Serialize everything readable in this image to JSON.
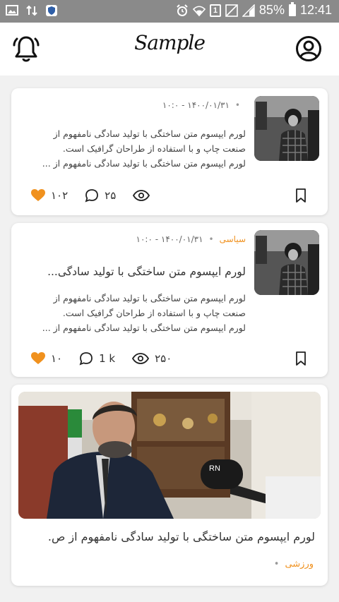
{
  "status_bar": {
    "sim_badge": "1",
    "battery": "85%",
    "time": "12:41"
  },
  "header": {
    "logo_text": "Sample"
  },
  "colors": {
    "accent": "#f0911e",
    "heart": "#f0911e"
  },
  "posts": [
    {
      "category": "",
      "date": "۱۴۰۰/۰۱/۳۱ - ۱۰:۰",
      "title": "",
      "body_lines": [
        "لورم ایپسوم متن ساختگی با تولید سادگی نامفهوم از",
        "صنعت چاپ و با استفاده از طراحان گرافیک است.",
        "لورم ایپسوم متن ساختگی با تولید سادگی نامفهوم از ..."
      ],
      "likes": "۱۰۲",
      "comments": "۲۵"
    },
    {
      "category": "سیاسی",
      "date": "۱۴۰۰/۰۱/۳۱ - ۱۰:۰",
      "title": "لورم ایپسوم متن ساختگی با تولید سادگی...",
      "body_lines": [
        "لورم ایپسوم متن ساختگی با تولید سادگی نامفهوم از",
        "صنعت چاپ و با استفاده از طراحان گرافیک است.",
        "لورم ایپسوم متن ساختگی با تولید سادگی نامفهوم از ..."
      ],
      "likes": "۱۰",
      "comments": "1 k",
      "views": "۲۵۰"
    },
    {
      "title": "لورم ایپسوم متن ساختگی با تولید سادگی نامفهوم از ص.",
      "category": "ورزشی",
      "image_caption_logo": "RN"
    }
  ]
}
